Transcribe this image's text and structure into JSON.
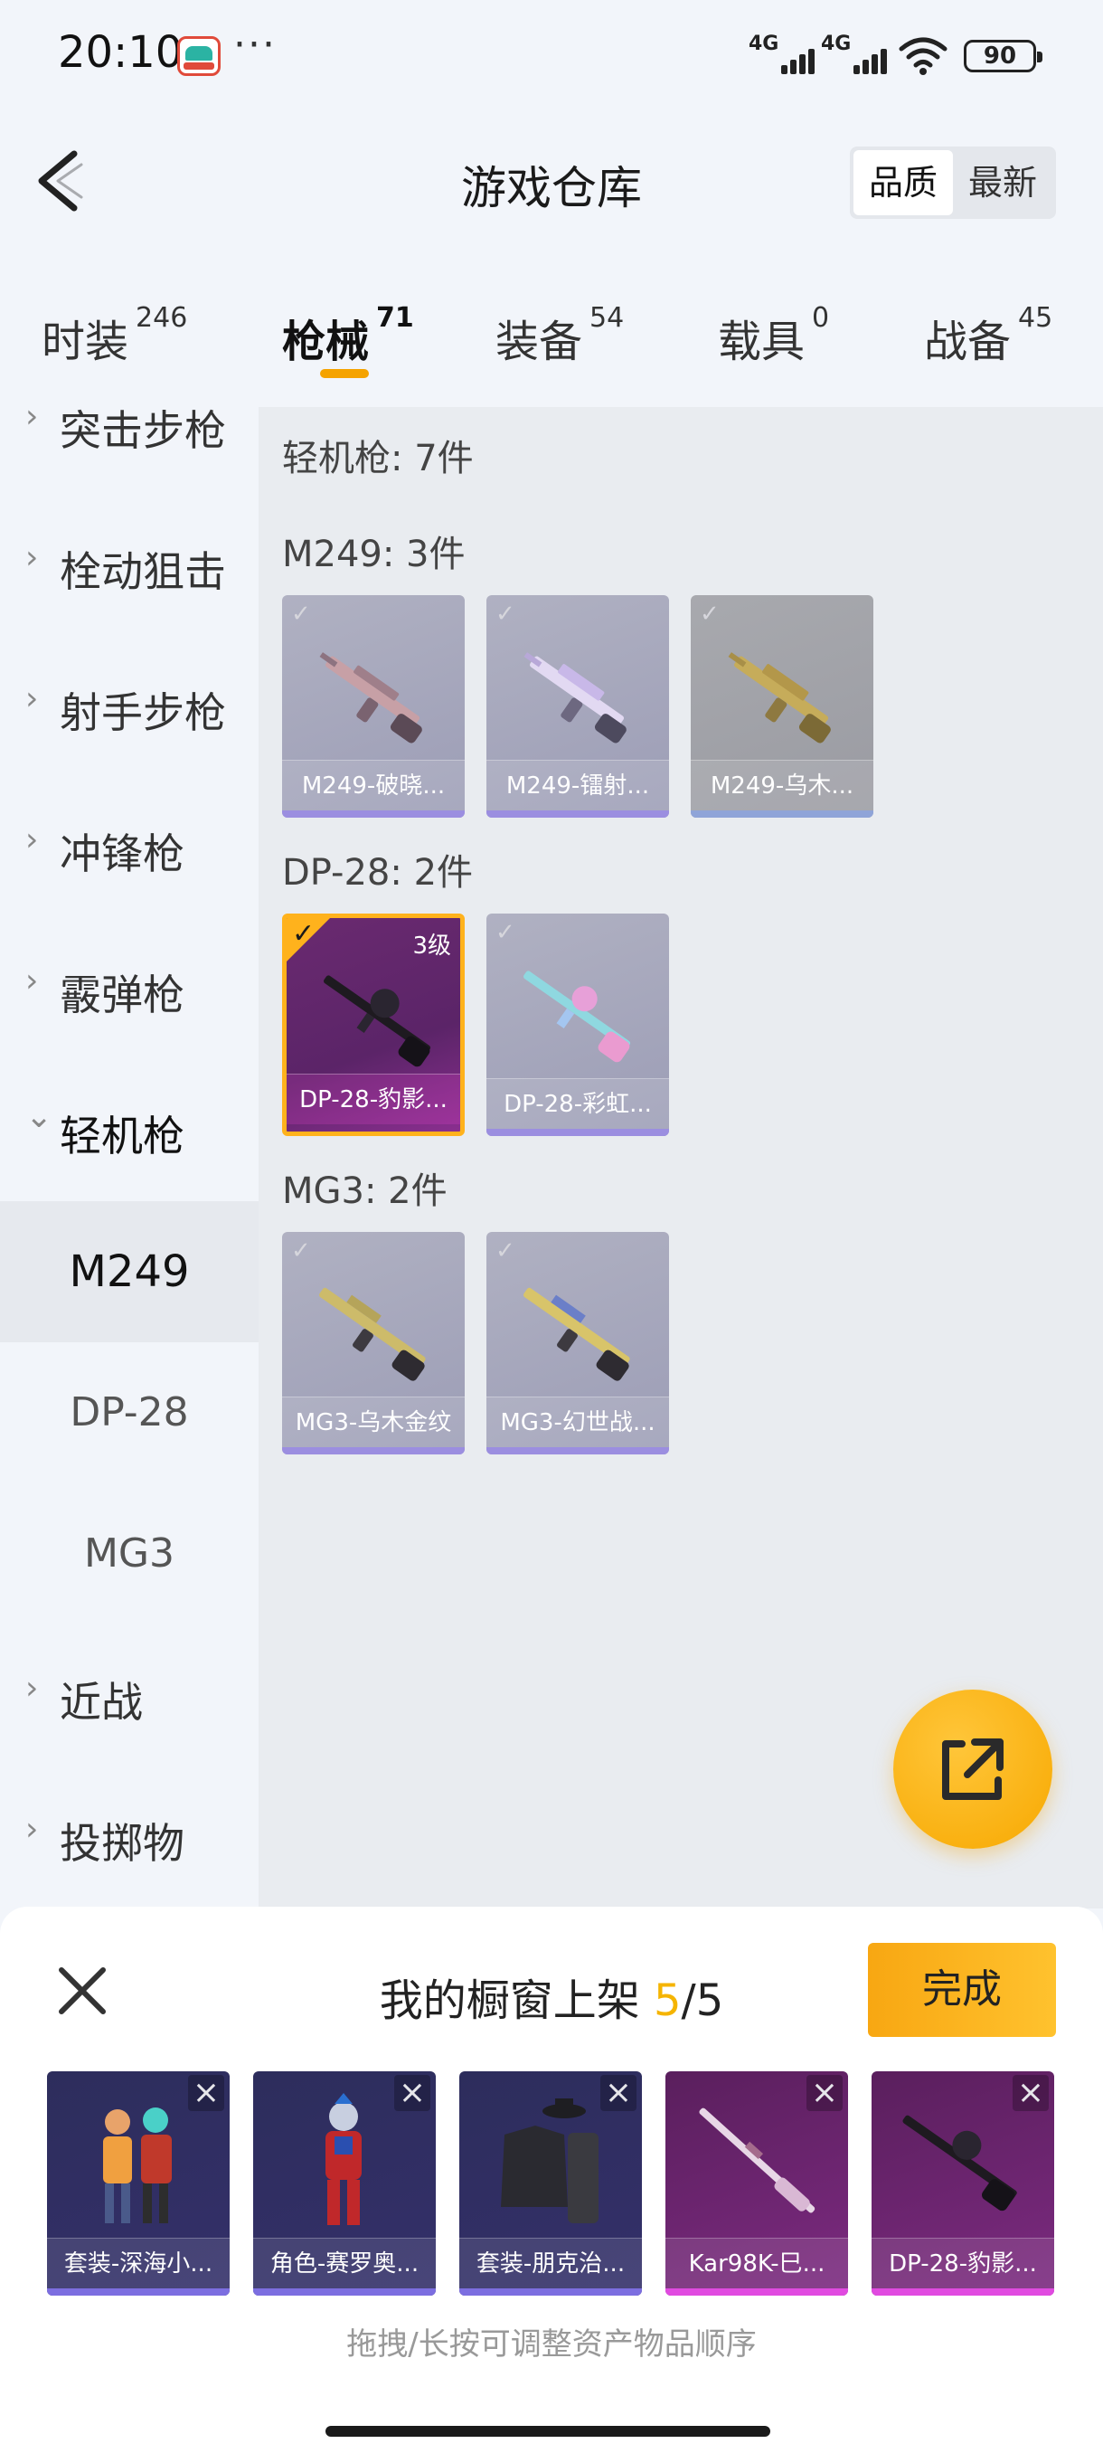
{
  "status_bar": {
    "time": "20:10",
    "dots": "···",
    "signal1_label": "4G",
    "signal2_label": "4G",
    "battery": "90"
  },
  "header": {
    "title": "游戏仓库",
    "sort_options": [
      "品质",
      "最新"
    ],
    "active_sort": "品质"
  },
  "tabs": [
    {
      "label": "时装",
      "count": "246"
    },
    {
      "label": "枪械",
      "count": "71",
      "active": true
    },
    {
      "label": "装备",
      "count": "54"
    },
    {
      "label": "载具",
      "count": "0"
    },
    {
      "label": "战备",
      "count": "45"
    }
  ],
  "sidebar": {
    "items": [
      {
        "label": "突击步枪",
        "chevron": "›"
      },
      {
        "label": "栓动狙击",
        "chevron": "›"
      },
      {
        "label": "射手步枪",
        "chevron": "›"
      },
      {
        "label": "冲锋枪",
        "chevron": "›"
      },
      {
        "label": "霰弹枪",
        "chevron": "›"
      },
      {
        "label": "轻机枪",
        "chevron": "⌄"
      },
      {
        "label": "近战",
        "chevron": "›"
      },
      {
        "label": "投掷物",
        "chevron": "›"
      }
    ],
    "sub_items": [
      "M249",
      "DP-28",
      "MG3"
    ],
    "active_sub": "M249"
  },
  "content": {
    "total_label": "轻机枪: 7件",
    "sections": [
      {
        "title": "M249: 3件",
        "items": [
          {
            "name": "M249-破晓...",
            "style": "purple"
          },
          {
            "name": "M249-镭射...",
            "style": "purple"
          },
          {
            "name": "M249-乌木...",
            "style": "gray"
          }
        ]
      },
      {
        "title": "DP-28: 2件",
        "items": [
          {
            "name": "DP-28-豹影...",
            "style": "selected",
            "level": "3级"
          },
          {
            "name": "DP-28-彩虹...",
            "style": "purple"
          }
        ]
      },
      {
        "title": "MG3: 2件",
        "items": [
          {
            "name": "MG3-乌木金纹",
            "style": "purple"
          },
          {
            "name": "MG3-幻世战...",
            "style": "purple"
          }
        ]
      }
    ]
  },
  "fab": {
    "icon": "share-external-icon"
  },
  "sheet": {
    "title_prefix": "我的橱窗上架 ",
    "count": "5",
    "total": "/5",
    "done_label": "完成",
    "items": [
      {
        "name": "套装-深海小...",
        "style": "blue"
      },
      {
        "name": "角色-赛罗奥...",
        "style": "blue"
      },
      {
        "name": "套装-朋克治...",
        "style": "blue"
      },
      {
        "name": "Kar98K-巳...",
        "style": "pink"
      },
      {
        "name": "DP-28-豹影...",
        "style": "pink"
      }
    ],
    "hint": "拖拽/长按可调整资产物品顺序"
  },
  "colors": {
    "accent": "#f5a300",
    "background": "#f2f5fa",
    "content_bg": "#e9ecf0"
  }
}
